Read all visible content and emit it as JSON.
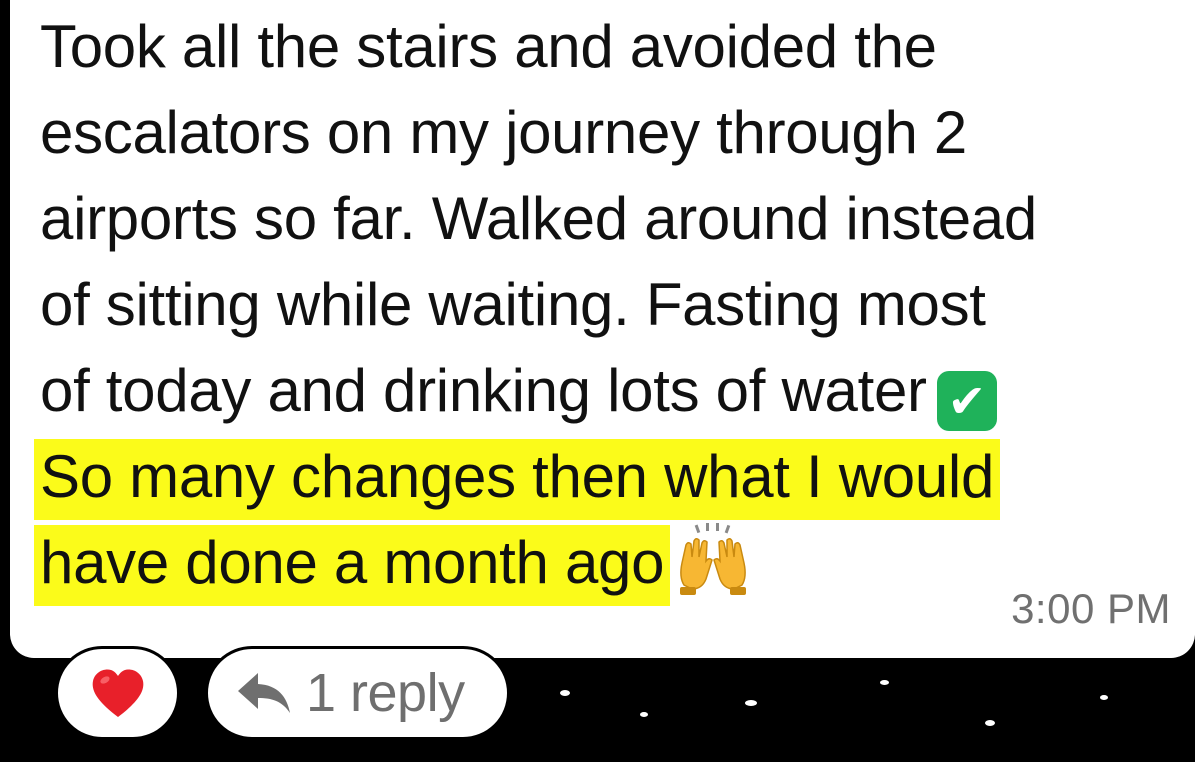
{
  "message": {
    "lines": [
      "Took all the stairs and avoided the",
      "escalators on my journey through 2",
      "airports so far. Walked around instead",
      "of sitting while waiting. Fasting most",
      "of today and drinking lots of water"
    ],
    "highlighted_lines": [
      "So many changes then what I would",
      "have done a month ago"
    ],
    "check_emoji": "✔",
    "time": "3:00 PM"
  },
  "reaction": {
    "icon": "heart-icon"
  },
  "reply": {
    "icon": "reply-arrow-icon",
    "label": "1 reply"
  },
  "colors": {
    "highlight": "#fbfb1a",
    "check_bg": "#1fb25a",
    "heart": "#e8202a",
    "time": "#707070",
    "reply_text": "#6f6f6f"
  }
}
